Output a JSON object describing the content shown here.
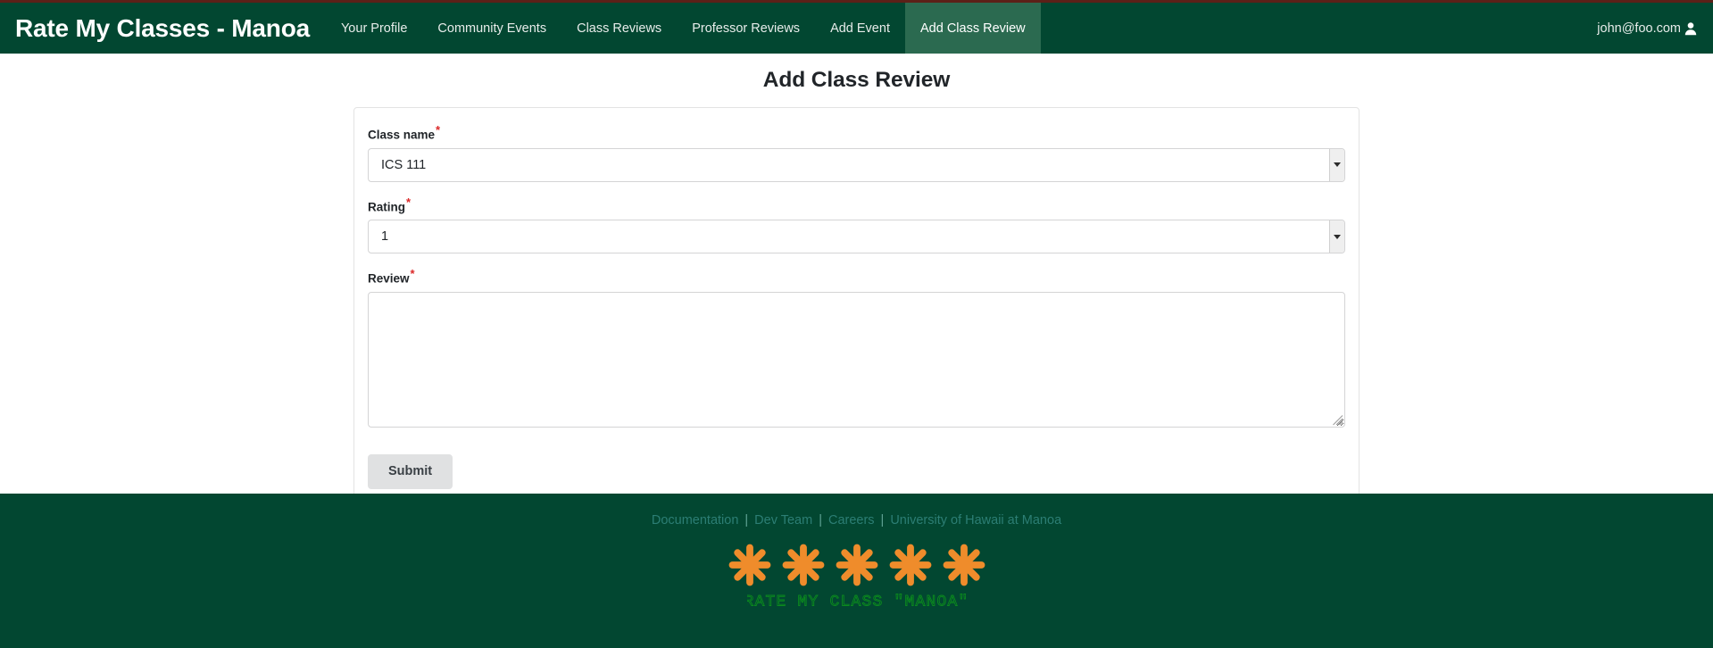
{
  "navbar": {
    "brand": "Rate My Classes - Manoa",
    "links": [
      {
        "label": "Your Profile",
        "active": false
      },
      {
        "label": "Community Events",
        "active": false
      },
      {
        "label": "Class Reviews",
        "active": false
      },
      {
        "label": "Professor Reviews",
        "active": false
      },
      {
        "label": "Add Event",
        "active": false
      },
      {
        "label": "Add Class Review",
        "active": true
      }
    ],
    "user_email": "john@foo.com",
    "user_icon": "user-icon",
    "background_color": "#024731",
    "active_tab_color": "#2b6a50"
  },
  "main": {
    "page_title": "Add Class Review",
    "form": {
      "fields": [
        {
          "label": "Class name",
          "required_marker": "*",
          "type": "select",
          "value": "ICS 111",
          "options": [
            "ICS 111"
          ]
        },
        {
          "label": "Rating",
          "required_marker": "*",
          "type": "select",
          "value": "1",
          "options": [
            "1"
          ]
        },
        {
          "label": "Review",
          "required_marker": "*",
          "type": "textarea",
          "value": "",
          "placeholder": ""
        }
      ],
      "submit_label": "Submit"
    }
  },
  "footer": {
    "links": [
      "Documentation",
      "Dev Team",
      "Careers",
      "University of Hawaii at Manoa"
    ],
    "separator": "|",
    "logo": {
      "flower_count": 5,
      "flower_color": "#ef8c2b",
      "text": "RATE MY CLASS \"MANOA\"",
      "text_color": "#0b8a1e"
    },
    "background_color": "#024731"
  },
  "colors": {
    "top_rule": "#5c2018",
    "brand_green": "#024731",
    "required_red": "#db2828",
    "orange": "#ef8c2b",
    "logo_green": "#0b8a1e"
  }
}
